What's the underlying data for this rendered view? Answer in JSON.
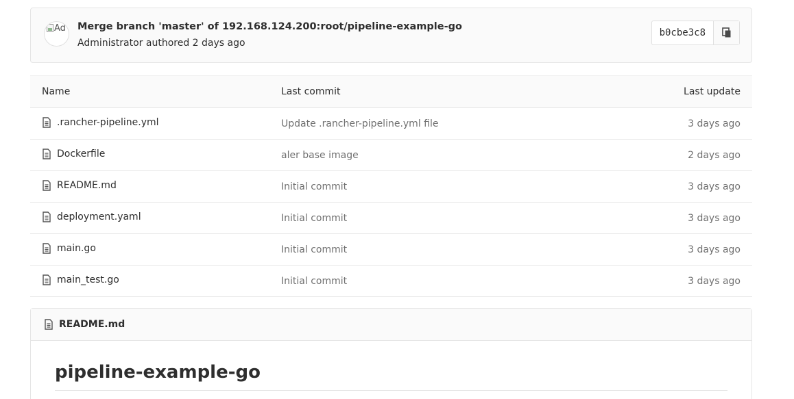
{
  "commit": {
    "avatar_alt": "Ad",
    "title": "Merge branch 'master' of 192.168.124.200:root/pipeline-example-go",
    "meta": "Administrator authored 2 days ago",
    "sha": "b0cbe3c8"
  },
  "table": {
    "headers": {
      "name": "Name",
      "last_commit": "Last commit",
      "last_update": "Last update"
    },
    "rows": [
      {
        "name": ".rancher-pipeline.yml",
        "commit": "Update .rancher-pipeline.yml file",
        "updated": "3 days ago"
      },
      {
        "name": "Dockerfile",
        "commit": "aler base image",
        "updated": "2 days ago"
      },
      {
        "name": "README.md",
        "commit": "Initial commit",
        "updated": "3 days ago"
      },
      {
        "name": "deployment.yaml",
        "commit": "Initial commit",
        "updated": "3 days ago"
      },
      {
        "name": "main.go",
        "commit": "Initial commit",
        "updated": "3 days ago"
      },
      {
        "name": "main_test.go",
        "commit": "Initial commit",
        "updated": "3 days ago"
      }
    ]
  },
  "readme": {
    "filename": "README.md",
    "heading": "pipeline-example-go"
  },
  "icons": {
    "file": "file-text-icon",
    "copy": "clipboard-icon"
  }
}
